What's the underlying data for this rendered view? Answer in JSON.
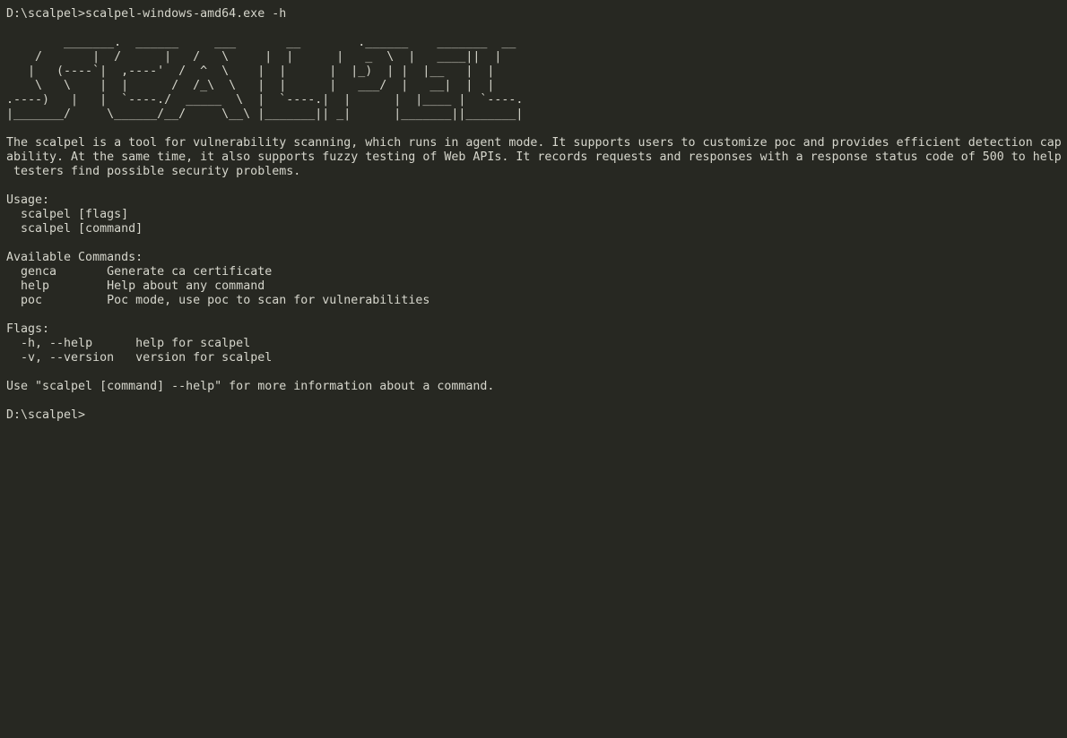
{
  "terminal": {
    "command_line": "D:\\scalpel>scalpel-windows-amd64.exe -h",
    "banner": [
      "        _______.  ______     ___       __        .______    _______  __",
      "    /       |  /      |   /   \\     |  |      |   _  \\  |   ____||  |",
      "   |   (----`|  ,----'  /  ^  \\    |  |      |  |_)  | |  |__   |  |",
      "    \\   \\    |  |      /  /_\\  \\   |  |      |   ___/  |   __|  |  |",
      ".----)   |   |  `----./  _____  \\  |  `----.|  |      |  |____ |  `----.",
      "|_______/     \\______/__/     \\__\\ |_______|| _|      |_______||_______|"
    ],
    "description": [
      "The scalpel is a tool for vulnerability scanning, which runs in agent mode. It supports users to customize poc and provides efficient detection cap",
      "ability. At the same time, it also supports fuzzy testing of Web APIs. It records requests and responses with a response status code of 500 to help",
      " testers find possible security problems."
    ],
    "usage_heading": "Usage:",
    "usage_lines": [
      "  scalpel [flags]",
      "  scalpel [command]"
    ],
    "commands_heading": "Available Commands:",
    "commands": [
      {
        "name": "genca",
        "desc": "Generate ca certificate"
      },
      {
        "name": "help",
        "desc": "Help about any command"
      },
      {
        "name": "poc",
        "desc": "Poc mode, use poc to scan for vulnerabilities"
      }
    ],
    "flags_heading": "Flags:",
    "flags": [
      {
        "flag": "-h, --help",
        "desc": "help for scalpel"
      },
      {
        "flag": "-v, --version",
        "desc": "version for scalpel"
      }
    ],
    "footer_hint": "Use \"scalpel [command] --help\" for more information about a command.",
    "prompt": "D:\\scalpel>"
  },
  "colors": {
    "background": "#272822",
    "foreground": "#d6d6cc"
  }
}
